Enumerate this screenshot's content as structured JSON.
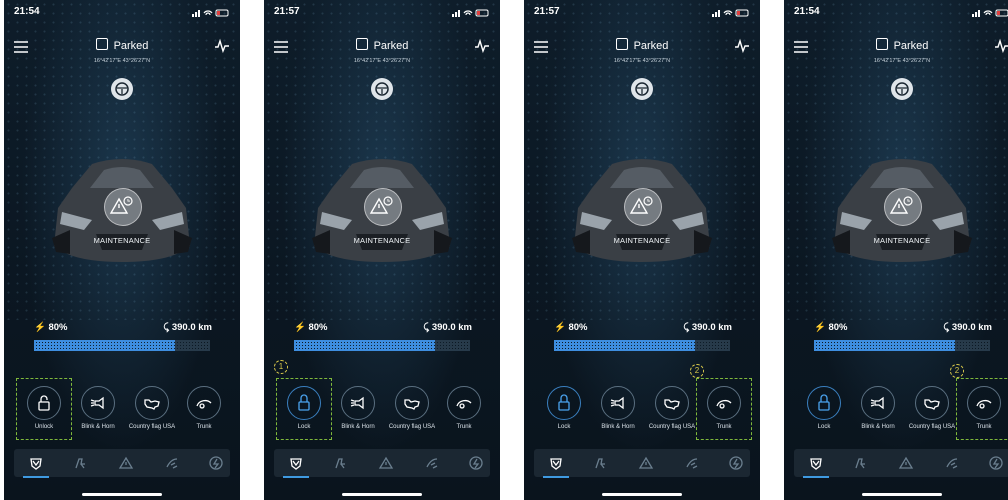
{
  "screens": [
    {
      "time": "21:54",
      "title": "Parked",
      "coords": "16°42'17\"E 43°26'27\"N",
      "status": "MAINTENANCE",
      "battery": "80%",
      "range": "390.0 km",
      "battery_fraction": 0.8,
      "actions": [
        "Unlock",
        "Blink & Horn",
        "Country flag USA",
        "Trunk"
      ],
      "highlight": "Unlock",
      "step": ""
    },
    {
      "time": "21:57",
      "title": "Parked",
      "coords": "16°42'17\"E 43°26'27\"N",
      "status": "MAINTENANCE",
      "battery": "80%",
      "range": "390.0 km",
      "battery_fraction": 0.8,
      "actions": [
        "Lock",
        "Blink & Horn",
        "Country flag USA",
        "Trunk"
      ],
      "highlight": "Lock",
      "step": "1"
    },
    {
      "time": "21:57",
      "title": "Parked",
      "coords": "16°42'17\"E 43°26'27\"N",
      "status": "MAINTENANCE",
      "battery": "80%",
      "range": "390.0 km",
      "battery_fraction": 0.8,
      "actions": [
        "Lock",
        "Blink & Horn",
        "Country flag USA",
        "Trunk"
      ],
      "highlight": "Trunk",
      "step": "2"
    },
    {
      "time": "21:54",
      "title": "Parked",
      "coords": "16°42'17\"E 43°26'27\"N",
      "status": "MAINTENANCE",
      "battery": "80%",
      "range": "390.0 km",
      "battery_fraction": 0.8,
      "actions": [
        "Lock",
        "Blink & Horn",
        "Country flag USA",
        "Trunk"
      ],
      "highlight": "Trunk",
      "step": "2"
    }
  ],
  "icons": {
    "actions": [
      "lock-icon",
      "blink-horn-icon",
      "country-flag-icon",
      "trunk-icon"
    ],
    "tabs": [
      "shield-icon",
      "seat-icon",
      "warning-icon",
      "wiper-icon",
      "charge-icon"
    ]
  },
  "colors": {
    "background": "#0b1722",
    "accent": "#3f9ae0",
    "highlight": "#7fb93b",
    "badge": "#d9c94a"
  }
}
